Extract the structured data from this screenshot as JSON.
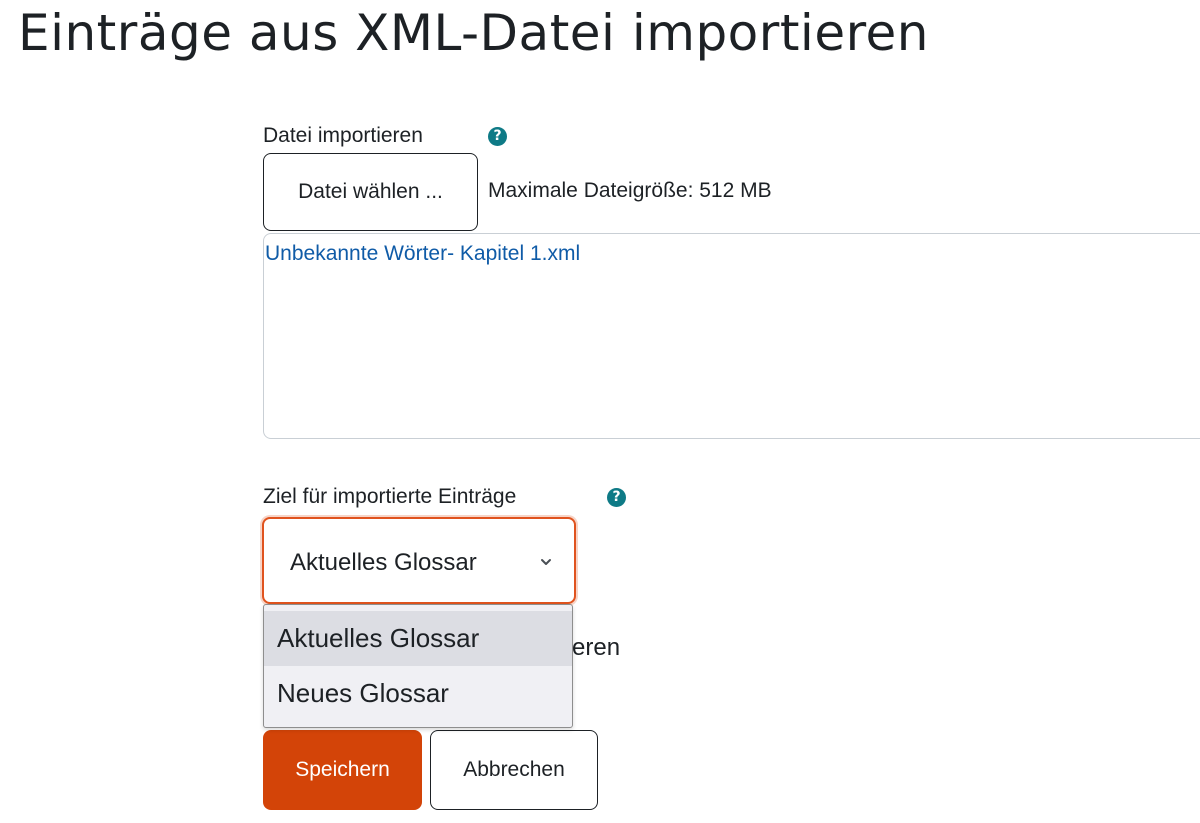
{
  "page": {
    "title": "Einträge aus XML-Datei importieren"
  },
  "file_import": {
    "label": "Datei importieren",
    "help_icon": "question-circle-icon",
    "choose_button": "Datei wählen ...",
    "max_size": "Maximale Dateigröße: 512 MB",
    "selected_file": "Unbekannte Wörter- Kapitel 1.xml"
  },
  "destination": {
    "label": "Ziel für importierte Einträge",
    "help_icon": "question-circle-icon",
    "selected_value": "Aktuelles Glossar",
    "options": [
      "Aktuelles Glossar",
      "Neues Glossar"
    ],
    "partially_hidden_label": "tieren"
  },
  "actions": {
    "save": "Speichern",
    "cancel": "Abbrechen"
  },
  "colors": {
    "primary": "#d34408",
    "focus_border": "#e0531e",
    "link": "#0f5ba7",
    "help_icon": "#0e7a86"
  }
}
